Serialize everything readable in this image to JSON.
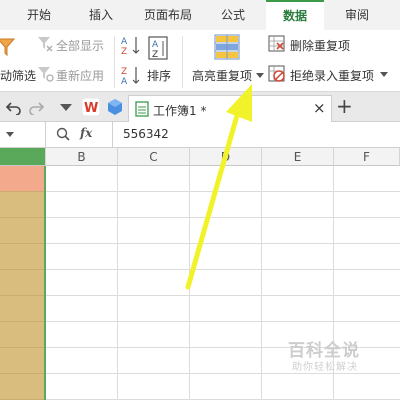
{
  "menu": {
    "tabs": [
      "开始",
      "插入",
      "页面布局",
      "公式",
      "数据",
      "审阅"
    ],
    "active_tab": "数据"
  },
  "ribbon": {
    "auto_filter_label": "动筛选",
    "show_all_label": "全部显示",
    "reapply_label": "重新应用",
    "sort_label": "排序",
    "highlight_duplicates_label": "高亮重复项",
    "remove_duplicates_label": "删除重复项",
    "reject_duplicates_label": "拒绝录入重复项"
  },
  "tabbar": {
    "document_title": "工作簿1 *",
    "close_symbol": "×",
    "add_symbol": "+"
  },
  "formula_bar": {
    "fx_label": "fx",
    "value": "556342"
  },
  "grid": {
    "column_headers": [
      "B",
      "C",
      "D",
      "E",
      "F"
    ]
  },
  "watermark": {
    "title": "百科全说",
    "subtitle": "助你轻松解决"
  },
  "colors": {
    "accent_green": "#3c9a4b",
    "arrow_yellow": "#f2f22a",
    "selected_column_fill": "#d9bd7f",
    "first_cell_fill": "#f3a98b"
  }
}
